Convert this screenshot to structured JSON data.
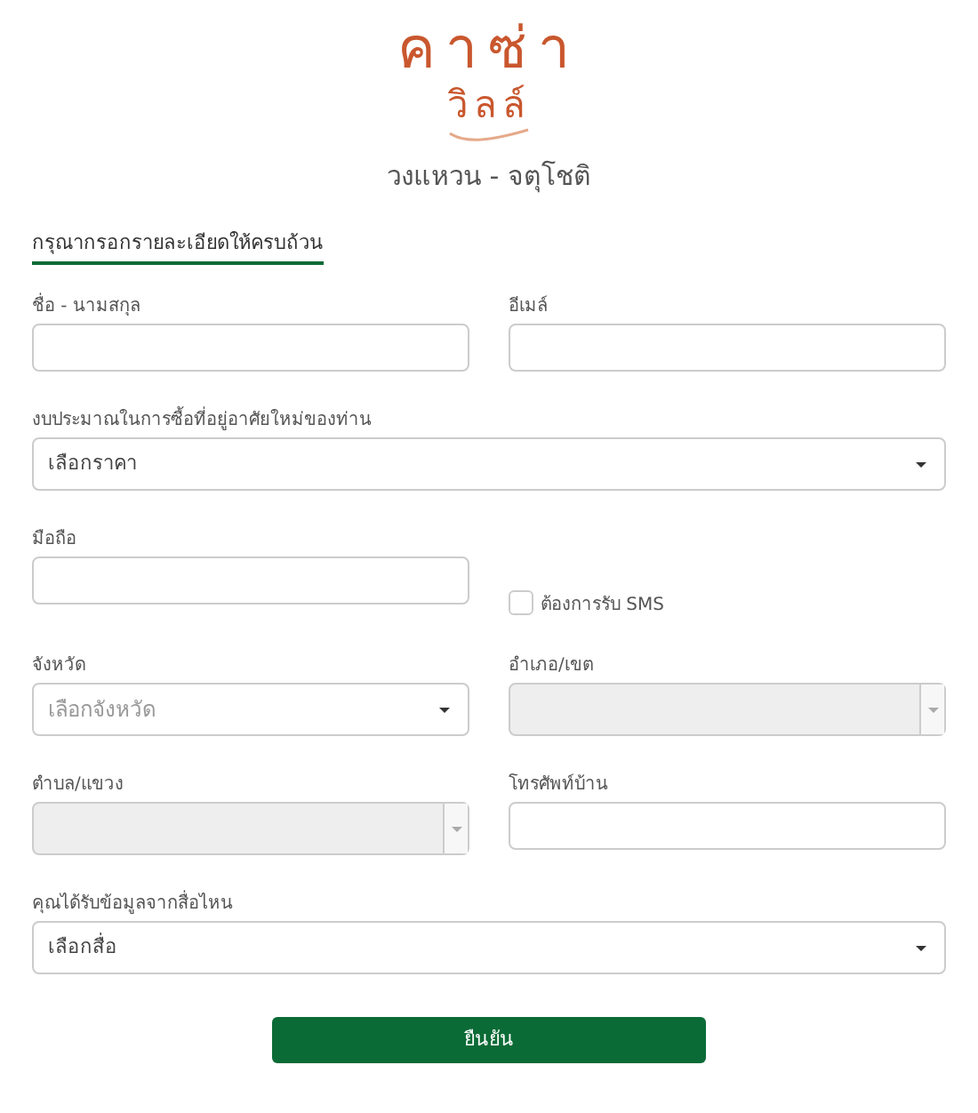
{
  "logo": {
    "line_1": "คาซ่า",
    "line_2": "วิลล์"
  },
  "subtitle": "วงแหวน - จตุโชติ",
  "heading": "กรุณากรอกรายละเอียดให้ครบถ้วน",
  "rows": [
    [
      {
        "kind": "text",
        "label": "ชื่อ - นามสกุล"
      },
      {
        "kind": "text",
        "label": "อีเมล์"
      }
    ],
    [
      {
        "kind": "select",
        "label": "งบประมาณในการซื้อที่อยู่อาศัยใหม่ของท่าน",
        "value": "เลือกราคา",
        "disabled": false
      }
    ],
    [
      {
        "kind": "text",
        "label": "มือถือ"
      },
      {
        "kind": "checkbox",
        "label": "ต้องการรับ SMS",
        "checked": false
      }
    ],
    [
      {
        "kind": "select",
        "label": "จังหวัด",
        "placeholder": "เลือกจังหวัด",
        "disabled": false
      },
      {
        "kind": "select",
        "label": "อำเภอ/เขต",
        "disabled": true
      }
    ],
    [
      {
        "kind": "select",
        "label": "ตำบล/แขวง",
        "disabled": true
      },
      {
        "kind": "text",
        "label": "โทรศัพท์บ้าน"
      }
    ],
    [
      {
        "kind": "select",
        "label": "คุณได้รับข้อมูลจากสื่อไหน",
        "value": "เลือกสื่อ",
        "disabled": false
      }
    ]
  ],
  "submit": "ยืนยัน"
}
